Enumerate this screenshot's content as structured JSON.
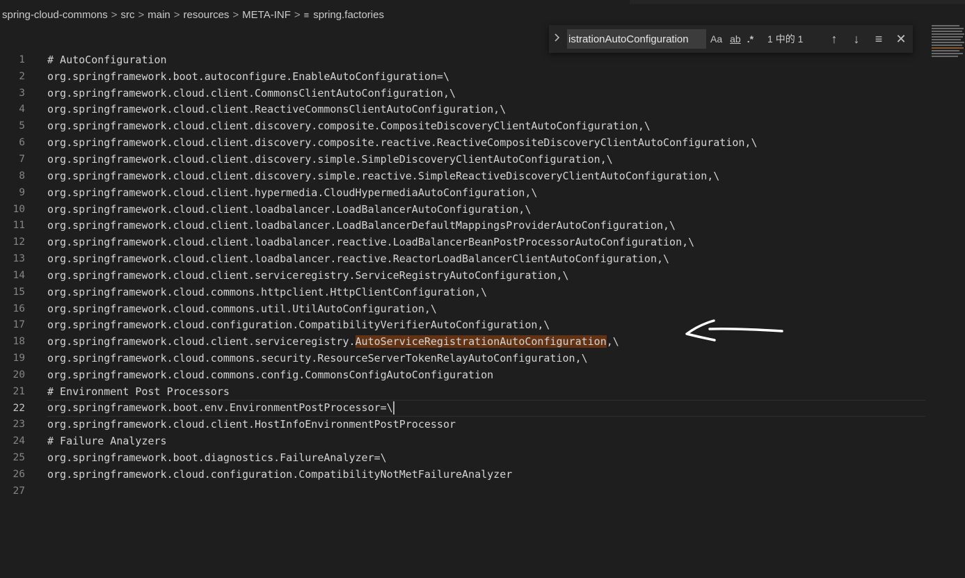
{
  "breadcrumb": {
    "items": [
      "spring-cloud-commons",
      "src",
      "main",
      "resources",
      "META-INF"
    ],
    "file": "spring.factories",
    "separator": ">",
    "file_icon": "≡"
  },
  "find": {
    "toggle_icon": "chevron-right-icon",
    "query": "istrationAutoConfiguration",
    "match_case_label": "Aa",
    "whole_word_label": "ab",
    "regex_label": ".*",
    "count": "1 中的 1",
    "prev_icon": "↑",
    "next_icon": "↓",
    "selection_icon": "≡",
    "close_icon": "✕"
  },
  "editor": {
    "lines": [
      {
        "n": "1",
        "text": "# AutoConfiguration"
      },
      {
        "n": "2",
        "text": "org.springframework.boot.autoconfigure.EnableAutoConfiguration=\\"
      },
      {
        "n": "3",
        "text": "org.springframework.cloud.client.CommonsClientAutoConfiguration,\\"
      },
      {
        "n": "4",
        "text": "org.springframework.cloud.client.ReactiveCommonsClientAutoConfiguration,\\"
      },
      {
        "n": "5",
        "text": "org.springframework.cloud.client.discovery.composite.CompositeDiscoveryClientAutoConfiguration,\\"
      },
      {
        "n": "6",
        "text": "org.springframework.cloud.client.discovery.composite.reactive.ReactiveCompositeDiscoveryClientAutoConfiguration,\\"
      },
      {
        "n": "7",
        "text": "org.springframework.cloud.client.discovery.simple.SimpleDiscoveryClientAutoConfiguration,\\"
      },
      {
        "n": "8",
        "text": "org.springframework.cloud.client.discovery.simple.reactive.SimpleReactiveDiscoveryClientAutoConfiguration,\\"
      },
      {
        "n": "9",
        "text": "org.springframework.cloud.client.hypermedia.CloudHypermediaAutoConfiguration,\\"
      },
      {
        "n": "10",
        "text": "org.springframework.cloud.client.loadbalancer.LoadBalancerAutoConfiguration,\\"
      },
      {
        "n": "11",
        "text": "org.springframework.cloud.client.loadbalancer.LoadBalancerDefaultMappingsProviderAutoConfiguration,\\"
      },
      {
        "n": "12",
        "text": "org.springframework.cloud.client.loadbalancer.reactive.LoadBalancerBeanPostProcessorAutoConfiguration,\\"
      },
      {
        "n": "13",
        "text": "org.springframework.cloud.client.loadbalancer.reactive.ReactorLoadBalancerClientAutoConfiguration,\\"
      },
      {
        "n": "14",
        "text": "org.springframework.cloud.client.serviceregistry.ServiceRegistryAutoConfiguration,\\"
      },
      {
        "n": "15",
        "text": "org.springframework.cloud.commons.httpclient.HttpClientConfiguration,\\"
      },
      {
        "n": "16",
        "text": "org.springframework.cloud.commons.util.UtilAutoConfiguration,\\"
      },
      {
        "n": "17",
        "text": "org.springframework.cloud.configuration.CompatibilityVerifierAutoConfiguration,\\"
      },
      {
        "n": "18",
        "pre": "org.springframework.cloud.client.serviceregistry.",
        "match": "AutoServiceRegistrationAutoConfiguration",
        "post": ",\\"
      },
      {
        "n": "19",
        "text": "org.springframework.cloud.commons.security.ResourceServerTokenRelayAutoConfiguration,\\"
      },
      {
        "n": "20",
        "text": "org.springframework.cloud.commons.config.CommonsConfigAutoConfiguration"
      },
      {
        "n": "21",
        "text": "# Environment Post Processors"
      },
      {
        "n": "22",
        "text": "org.springframework.boot.env.EnvironmentPostProcessor=\\",
        "current": true
      },
      {
        "n": "23",
        "text": "org.springframework.cloud.client.HostInfoEnvironmentPostProcessor"
      },
      {
        "n": "24",
        "text": "# Failure Analyzers"
      },
      {
        "n": "25",
        "text": "org.springframework.boot.diagnostics.FailureAnalyzer=\\"
      },
      {
        "n": "26",
        "text": "org.springframework.cloud.configuration.CompatibilityNotMetFailureAnalyzer"
      },
      {
        "n": "27",
        "text": ""
      }
    ]
  },
  "annotation": {
    "icon": "hand-drawn-arrow-icon",
    "color": "#ffffff"
  },
  "colors": {
    "background": "#1e1e1e",
    "match_highlight": "#613214",
    "text": "#d4d4d4",
    "line_number": "#858585"
  }
}
